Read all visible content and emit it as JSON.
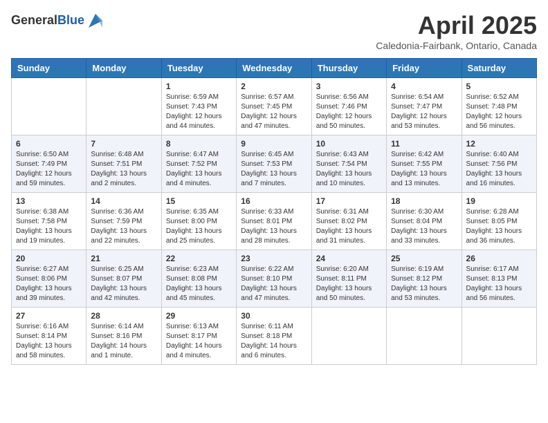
{
  "header": {
    "logo_general": "General",
    "logo_blue": "Blue",
    "month_title": "April 2025",
    "subtitle": "Caledonia-Fairbank, Ontario, Canada"
  },
  "weekdays": [
    "Sunday",
    "Monday",
    "Tuesday",
    "Wednesday",
    "Thursday",
    "Friday",
    "Saturday"
  ],
  "weeks": [
    [
      {
        "day": "",
        "info": ""
      },
      {
        "day": "",
        "info": ""
      },
      {
        "day": "1",
        "info": "Sunrise: 6:59 AM\nSunset: 7:43 PM\nDaylight: 12 hours and 44 minutes."
      },
      {
        "day": "2",
        "info": "Sunrise: 6:57 AM\nSunset: 7:45 PM\nDaylight: 12 hours and 47 minutes."
      },
      {
        "day": "3",
        "info": "Sunrise: 6:56 AM\nSunset: 7:46 PM\nDaylight: 12 hours and 50 minutes."
      },
      {
        "day": "4",
        "info": "Sunrise: 6:54 AM\nSunset: 7:47 PM\nDaylight: 12 hours and 53 minutes."
      },
      {
        "day": "5",
        "info": "Sunrise: 6:52 AM\nSunset: 7:48 PM\nDaylight: 12 hours and 56 minutes."
      }
    ],
    [
      {
        "day": "6",
        "info": "Sunrise: 6:50 AM\nSunset: 7:49 PM\nDaylight: 12 hours and 59 minutes."
      },
      {
        "day": "7",
        "info": "Sunrise: 6:48 AM\nSunset: 7:51 PM\nDaylight: 13 hours and 2 minutes."
      },
      {
        "day": "8",
        "info": "Sunrise: 6:47 AM\nSunset: 7:52 PM\nDaylight: 13 hours and 4 minutes."
      },
      {
        "day": "9",
        "info": "Sunrise: 6:45 AM\nSunset: 7:53 PM\nDaylight: 13 hours and 7 minutes."
      },
      {
        "day": "10",
        "info": "Sunrise: 6:43 AM\nSunset: 7:54 PM\nDaylight: 13 hours and 10 minutes."
      },
      {
        "day": "11",
        "info": "Sunrise: 6:42 AM\nSunset: 7:55 PM\nDaylight: 13 hours and 13 minutes."
      },
      {
        "day": "12",
        "info": "Sunrise: 6:40 AM\nSunset: 7:56 PM\nDaylight: 13 hours and 16 minutes."
      }
    ],
    [
      {
        "day": "13",
        "info": "Sunrise: 6:38 AM\nSunset: 7:58 PM\nDaylight: 13 hours and 19 minutes."
      },
      {
        "day": "14",
        "info": "Sunrise: 6:36 AM\nSunset: 7:59 PM\nDaylight: 13 hours and 22 minutes."
      },
      {
        "day": "15",
        "info": "Sunrise: 6:35 AM\nSunset: 8:00 PM\nDaylight: 13 hours and 25 minutes."
      },
      {
        "day": "16",
        "info": "Sunrise: 6:33 AM\nSunset: 8:01 PM\nDaylight: 13 hours and 28 minutes."
      },
      {
        "day": "17",
        "info": "Sunrise: 6:31 AM\nSunset: 8:02 PM\nDaylight: 13 hours and 31 minutes."
      },
      {
        "day": "18",
        "info": "Sunrise: 6:30 AM\nSunset: 8:04 PM\nDaylight: 13 hours and 33 minutes."
      },
      {
        "day": "19",
        "info": "Sunrise: 6:28 AM\nSunset: 8:05 PM\nDaylight: 13 hours and 36 minutes."
      }
    ],
    [
      {
        "day": "20",
        "info": "Sunrise: 6:27 AM\nSunset: 8:06 PM\nDaylight: 13 hours and 39 minutes."
      },
      {
        "day": "21",
        "info": "Sunrise: 6:25 AM\nSunset: 8:07 PM\nDaylight: 13 hours and 42 minutes."
      },
      {
        "day": "22",
        "info": "Sunrise: 6:23 AM\nSunset: 8:08 PM\nDaylight: 13 hours and 45 minutes."
      },
      {
        "day": "23",
        "info": "Sunrise: 6:22 AM\nSunset: 8:10 PM\nDaylight: 13 hours and 47 minutes."
      },
      {
        "day": "24",
        "info": "Sunrise: 6:20 AM\nSunset: 8:11 PM\nDaylight: 13 hours and 50 minutes."
      },
      {
        "day": "25",
        "info": "Sunrise: 6:19 AM\nSunset: 8:12 PM\nDaylight: 13 hours and 53 minutes."
      },
      {
        "day": "26",
        "info": "Sunrise: 6:17 AM\nSunset: 8:13 PM\nDaylight: 13 hours and 56 minutes."
      }
    ],
    [
      {
        "day": "27",
        "info": "Sunrise: 6:16 AM\nSunset: 8:14 PM\nDaylight: 13 hours and 58 minutes."
      },
      {
        "day": "28",
        "info": "Sunrise: 6:14 AM\nSunset: 8:16 PM\nDaylight: 14 hours and 1 minute."
      },
      {
        "day": "29",
        "info": "Sunrise: 6:13 AM\nSunset: 8:17 PM\nDaylight: 14 hours and 4 minutes."
      },
      {
        "day": "30",
        "info": "Sunrise: 6:11 AM\nSunset: 8:18 PM\nDaylight: 14 hours and 6 minutes."
      },
      {
        "day": "",
        "info": ""
      },
      {
        "day": "",
        "info": ""
      },
      {
        "day": "",
        "info": ""
      }
    ]
  ]
}
